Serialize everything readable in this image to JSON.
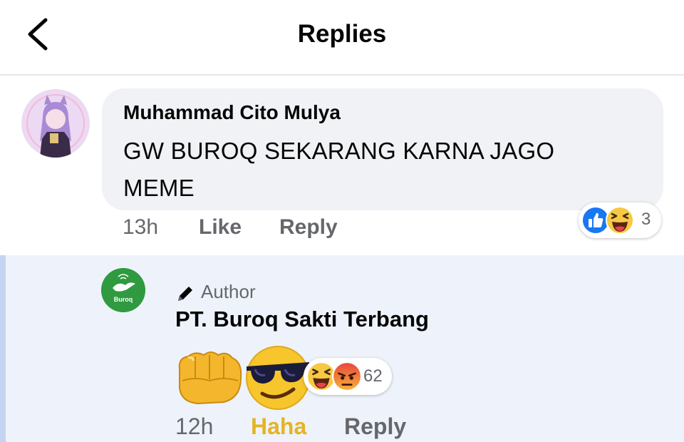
{
  "header": {
    "title": "Replies",
    "back_icon": "chevron-left-icon"
  },
  "comment": {
    "author": "Muhammad Cito Mulya",
    "text": "GW BUROQ SEKARANG KARNA JAGO MEME",
    "time": "13h",
    "like_label": "Like",
    "reply_label": "Reply",
    "reactions": {
      "icons": [
        "like-icon",
        "haha-icon"
      ],
      "count": "3"
    }
  },
  "reply": {
    "badge_icon": "pencil-icon",
    "badge_label": "Author",
    "author": "PT. Buroq Sakti Terbang",
    "avatar_text": "Buroq",
    "content_emojis": [
      "fist-emoji",
      "sunglasses-emoji"
    ],
    "time": "12h",
    "reaction_label": "Haha",
    "reply_label": "Reply",
    "reactions": {
      "icons": [
        "haha-icon",
        "angry-icon"
      ],
      "count": "62"
    }
  },
  "colors": {
    "bubble": "#f0f2f5",
    "reply_background": "#eef3fb",
    "reply_bar": "#c5d4f1",
    "secondary_text": "#65676b",
    "haha_label": "#e6b325",
    "like_blue": "#1877f2",
    "brand_green": "#2f9a3f"
  }
}
